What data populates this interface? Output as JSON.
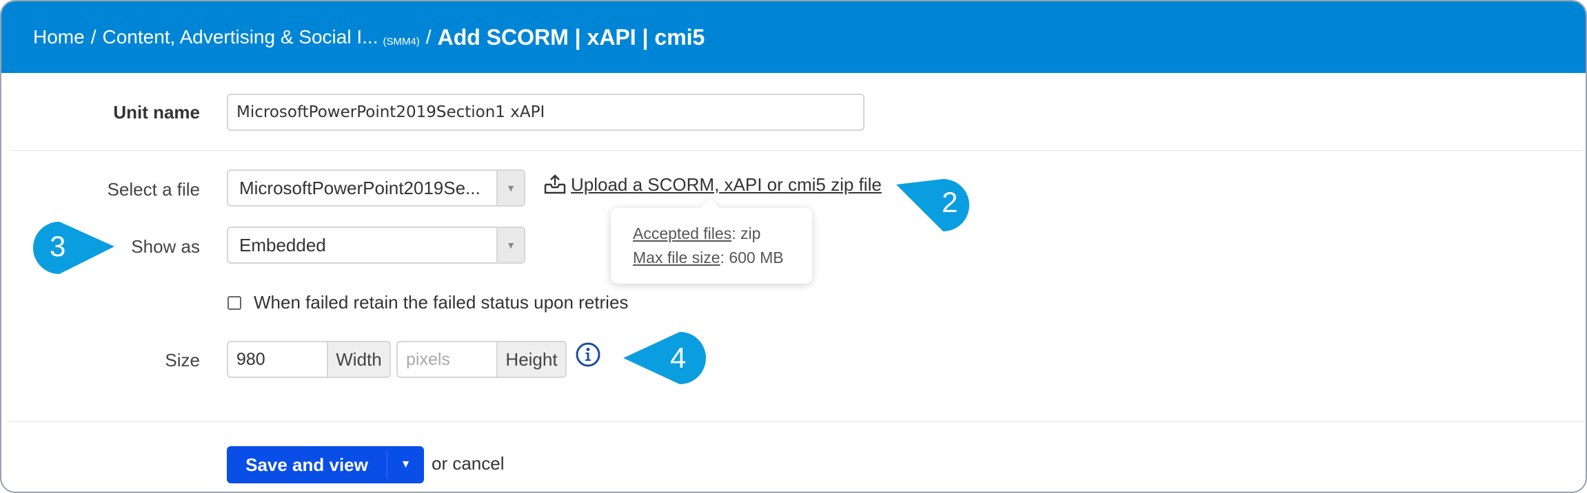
{
  "breadcrumb": {
    "home": "Home",
    "sep1": "/",
    "course": "Content, Advertising & Social I...",
    "course_code": "(SMM4)",
    "sep2": "/",
    "current": "Add SCORM | xAPI | cmi5"
  },
  "form": {
    "unit_name_label": "Unit name",
    "unit_name_value": "MicrosoftPowerPoint2019Section1 xAPI",
    "select_file_label": "Select a file",
    "select_file_value": "MicrosoftPowerPoint2019Se...",
    "upload_link": "Upload a SCORM, xAPI or cmi5 zip file",
    "tooltip": {
      "accepted_label": "Accepted files",
      "accepted_value": ": zip",
      "max_label": "Max file size",
      "max_value": ": 600 MB"
    },
    "show_as_label": "Show as",
    "show_as_value": "Embedded",
    "retain_failed_label": "When failed retain the failed status upon retries",
    "retain_failed_checked": false,
    "size_label": "Size",
    "width_value": "980",
    "width_addon": "Width",
    "height_placeholder": "pixels",
    "height_addon": "Height"
  },
  "actions": {
    "save_label": "Save and view",
    "or_text": "or ",
    "cancel_label": "cancel"
  },
  "callouts": {
    "c2": "2",
    "c3": "3",
    "c4": "4",
    "color": "#0a9ee0"
  },
  "colors": {
    "header_bg": "#0085d6",
    "primary_button": "#0a4ee8"
  },
  "icons": {
    "upload": "upload-tray-icon",
    "info": "info-circle-icon",
    "dropdown": "triangle-down-icon"
  }
}
